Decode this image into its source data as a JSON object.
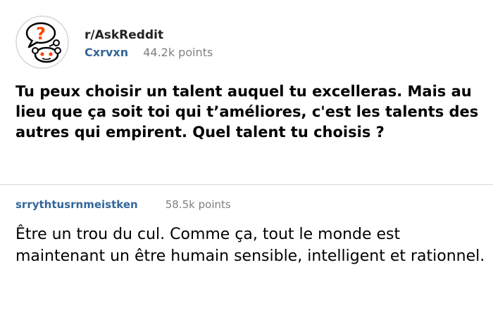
{
  "post": {
    "subreddit": "r/AskReddit",
    "author": "Cxrvxn",
    "points": "44.2k points",
    "title": "Tu peux choisir un talent auquel tu excelleras. Mais au lieu que ça soit toi qui t’améliores, c'est les talents des autres qui empirent. Quel talent tu choisis ?",
    "avatar_icon": "reddit-alien-question-icon"
  },
  "comment": {
    "author": "srrythtusrnmeistken",
    "points": "58.5k points",
    "body": "Être un trou du cul. Comme ça, tout le monde est maintenant un être humain sensible, intelligent et rationnel."
  },
  "colors": {
    "author_link": "#336699",
    "points_gray": "#808080",
    "question_mark": "#ff4500"
  }
}
